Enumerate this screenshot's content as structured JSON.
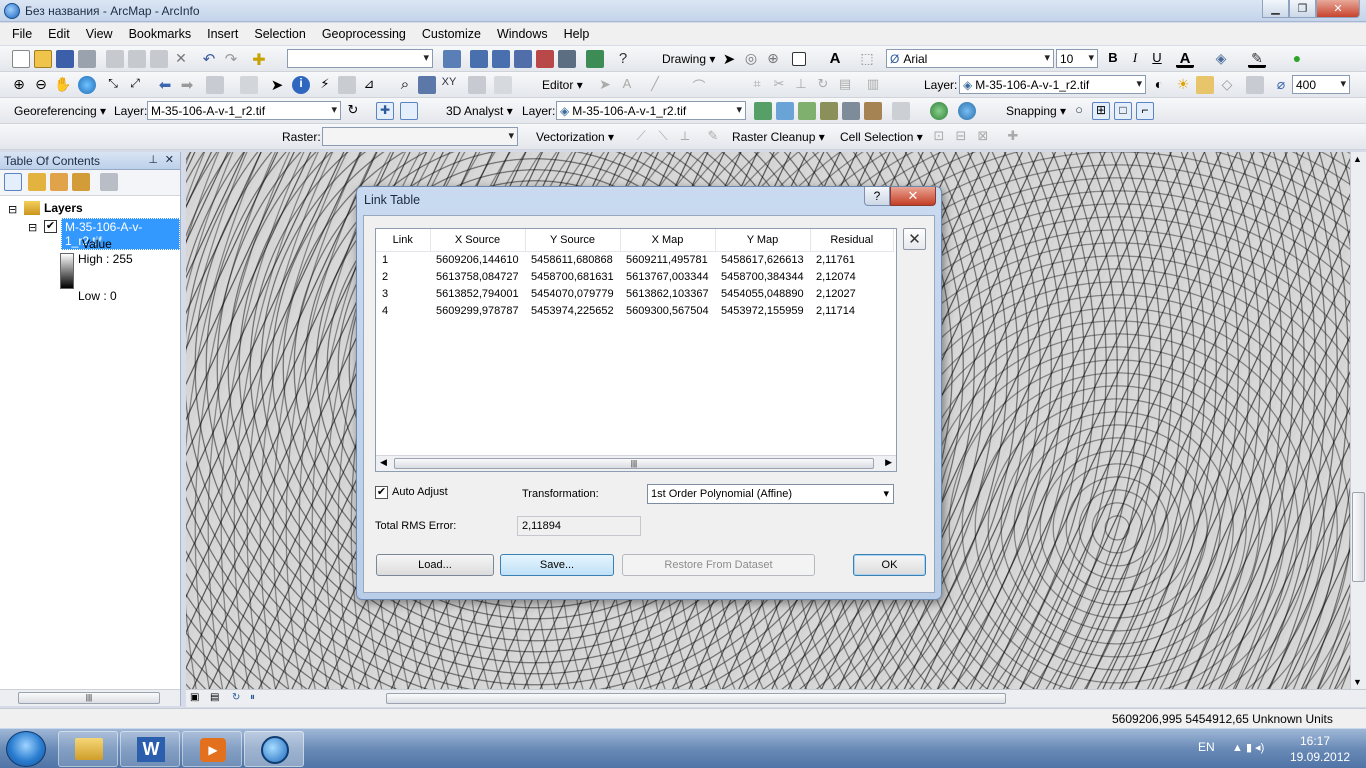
{
  "window": {
    "title": "Без названия - ArcMap - ArcInfo"
  },
  "menu": [
    "File",
    "Edit",
    "View",
    "Bookmarks",
    "Insert",
    "Selection",
    "Geoprocessing",
    "Customize",
    "Windows",
    "Help"
  ],
  "toolbar1": {
    "drawing_label": "Drawing",
    "font_name": "Arial",
    "font_size": "10",
    "bold": "B",
    "italic": "I",
    "underline": "U"
  },
  "toolbar2": {
    "editor_label": "Editor",
    "layer_label": "Layer:",
    "layer_value": "M-35-106-A-v-1_r2.tif",
    "zoom_value": "400"
  },
  "toolbar3": {
    "georef_label": "Georeferencing",
    "layer_label": "Layer:",
    "layer_value": "M-35-106-A-v-1_r2.tif",
    "analyst_label": "3D Analyst",
    "layer2_label": "Layer:",
    "layer2_value": "M-35-106-A-v-1_r2.tif",
    "snapping_label": "Snapping"
  },
  "toolbar4": {
    "raster_label": "Raster:",
    "raster_value": "",
    "vectorization_label": "Vectorization",
    "raster_cleanup_label": "Raster Cleanup",
    "cell_selection_label": "Cell Selection"
  },
  "toc": {
    "title": "Table Of Contents",
    "root": "Layers",
    "layer": "M-35-106-A-v-1_r2.tif",
    "value_label": "Value",
    "high": "High : 255",
    "low": "Low : 0"
  },
  "dialog": {
    "title": "Link Table",
    "help": "?",
    "columns": [
      "Link",
      "X Source",
      "Y Source",
      "X Map",
      "Y Map",
      "Residual"
    ],
    "rows": [
      [
        "1",
        "5609206,144610",
        "5458611,680868",
        "5609211,495781",
        "5458617,626613",
        "2,11761"
      ],
      [
        "2",
        "5613758,084727",
        "5458700,681631",
        "5613767,003344",
        "5458700,384344",
        "2,12074"
      ],
      [
        "3",
        "5613852,794001",
        "5454070,079779",
        "5613862,103367",
        "5454055,048890",
        "2,12027"
      ],
      [
        "4",
        "5609299,978787",
        "5453974,225652",
        "5609300,567504",
        "5453972,155959",
        "2,11714"
      ]
    ],
    "auto_adjust_label": "Auto Adjust",
    "transformation_label": "Transformation:",
    "transformation_value": "1st Order Polynomial (Affine)",
    "rms_label": "Total RMS Error:",
    "rms_value": "2,11894",
    "buttons": {
      "load": "Load...",
      "save": "Save...",
      "restore": "Restore From Dataset",
      "ok": "OK"
    }
  },
  "status": {
    "coords": "5609206,995  5454912,65 Unknown Units"
  },
  "taskbar": {
    "lang": "EN",
    "time": "16:17",
    "date": "19.09.2012"
  },
  "colors": {
    "accent": "#3399ff",
    "selection": "#3399ff"
  }
}
